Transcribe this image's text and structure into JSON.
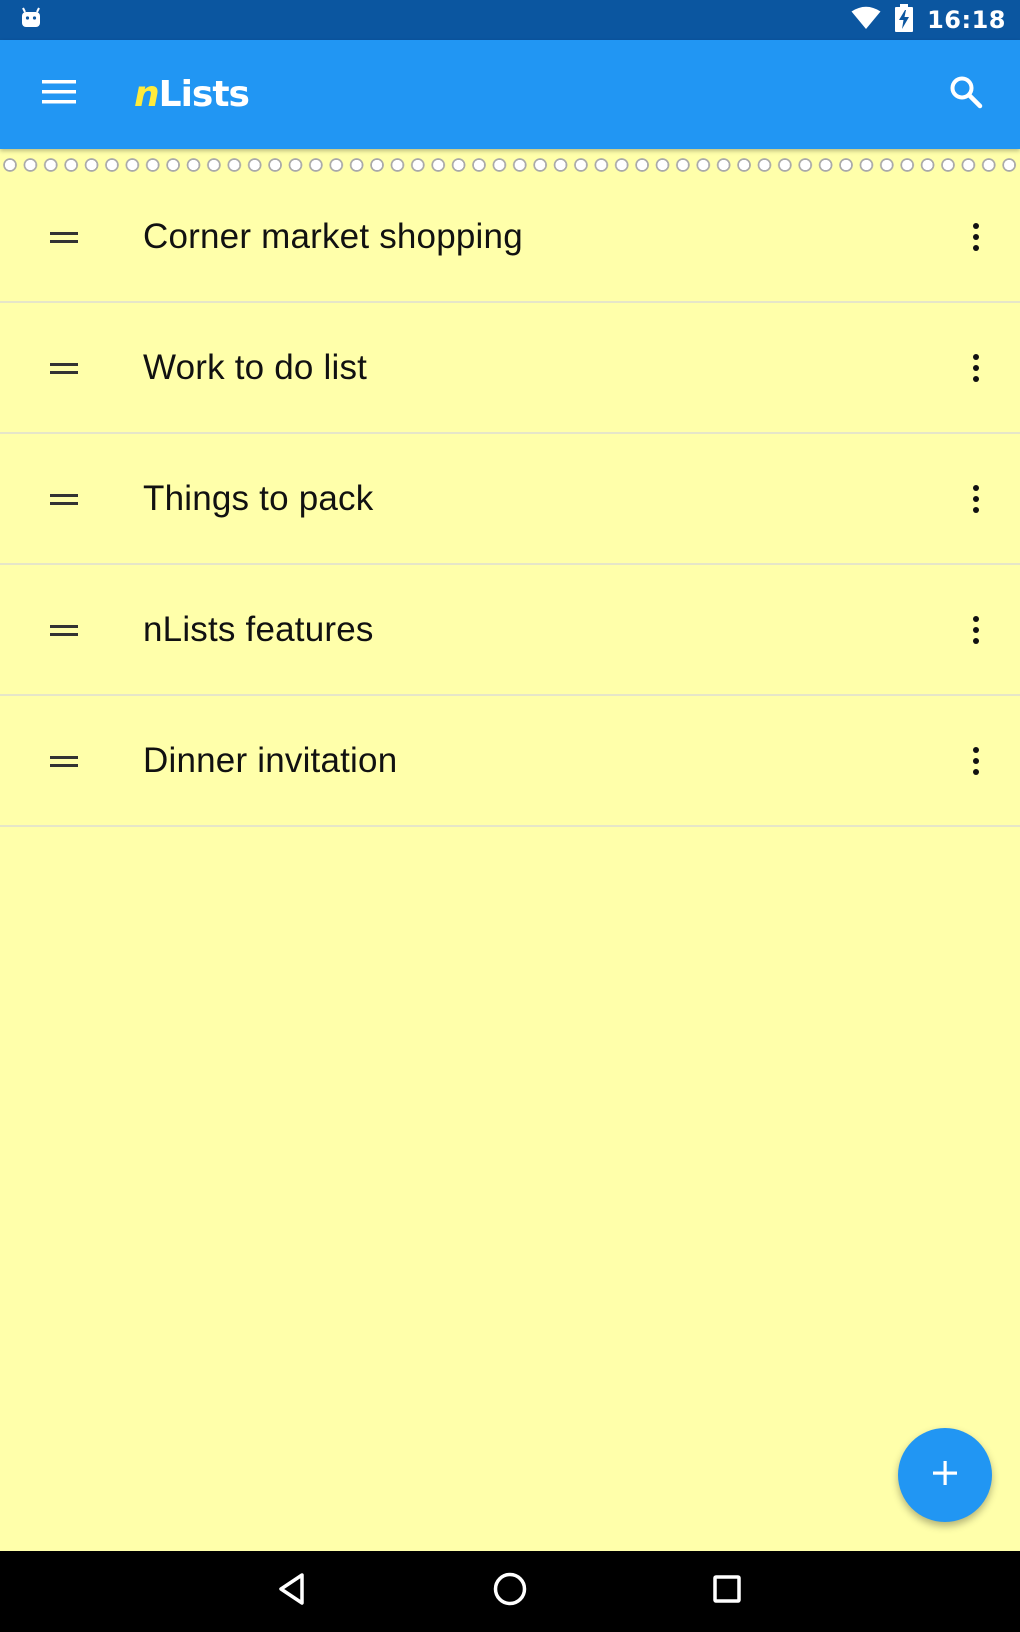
{
  "status_bar": {
    "left_icon": "android-icon",
    "wifi_icon": "wifi-icon",
    "battery_icon": "battery-charging-icon",
    "time": "16:18"
  },
  "app_bar": {
    "menu_icon": "hamburger-menu-icon",
    "title_prefix": "n",
    "title_rest": "Lists",
    "search_icon": "search-icon",
    "background_color": "#2196F3",
    "title_accent_color": "#FFEB3B"
  },
  "lists": {
    "items": [
      {
        "label": "Corner market shopping"
      },
      {
        "label": "Work to do list"
      },
      {
        "label": "Things to pack"
      },
      {
        "label": "nLists features"
      },
      {
        "label": "Dinner invitation"
      }
    ],
    "background_color": "#FFFFAA"
  },
  "fab": {
    "icon": "plus-icon",
    "color": "#2196F3"
  },
  "nav_bar": {
    "back_icon": "back-triangle-icon",
    "home_icon": "home-circle-icon",
    "recents_icon": "recents-square-icon"
  }
}
